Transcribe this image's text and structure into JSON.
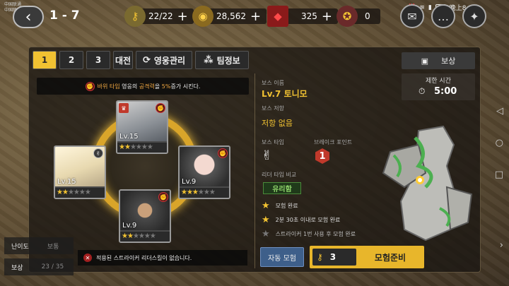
{
  "status": {
    "carrier1": "中国联通",
    "carrier2": "中国联通",
    "battery": "84",
    "time": "晚上8:52"
  },
  "header": {
    "stage": "1 - 7",
    "stamina": "22/22",
    "gold": "28,562",
    "gems": "325",
    "tickets": "0"
  },
  "tabs": [
    {
      "label": "1"
    },
    {
      "label": "2"
    },
    {
      "label": "3"
    },
    {
      "label": "대전"
    },
    {
      "label": "영웅관리"
    },
    {
      "label": "팀정보"
    }
  ],
  "reward_label": "보상",
  "buff": {
    "pre": "바위 타입",
    "mid": " 영웅의 ",
    "stat": "공격력",
    "mid2": "을 ",
    "pct": "5%",
    "post": "증가 시킨다."
  },
  "heroes": [
    {
      "level": "Lv.15",
      "stars": 2
    },
    {
      "level": "Lv.15",
      "stars": 2
    },
    {
      "level": "Lv.9",
      "stars": 3
    },
    {
      "level": "Lv.9",
      "stars": 2
    }
  ],
  "warning": "적용된 스트라이커 리더스킬이 없습니다.",
  "side": {
    "difficulty_label": "난이도",
    "difficulty_value": "보통",
    "reward_label": "보상",
    "reward_value": "23 / 35"
  },
  "boss": {
    "name_label": "보스 이름",
    "name": "Lv.7 토니모",
    "resist_label": "보스 저항",
    "resist": "저항 없음",
    "type_label": "보스 타입",
    "break_label": "브레이크 포인트",
    "break_value": "1",
    "leader_label": "리더 타입 비교",
    "leader_value": "유리함"
  },
  "time_limit": {
    "label": "제한 시간",
    "value": "5:00"
  },
  "missions": [
    {
      "text": "모험 완료"
    },
    {
      "text": "2분 30초 이내로 모험 완료"
    },
    {
      "text": "스트라이커 1번 사용 후 모험 완료"
    }
  ],
  "buttons": {
    "auto": "자동 모험",
    "cost": "3",
    "ready": "모험준비"
  }
}
